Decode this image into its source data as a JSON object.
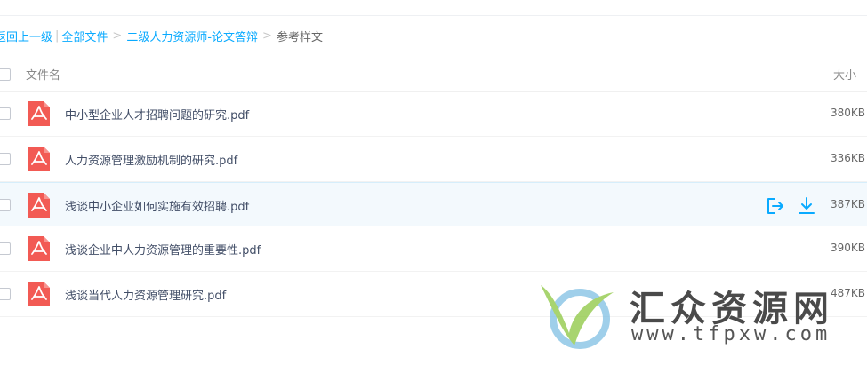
{
  "breadcrumb": {
    "back": "返回上一级",
    "divider": "|",
    "all_files": "全部文件",
    "folder": "二级人力资源师-论文答辩",
    "current": "参考样文",
    "sep": ">"
  },
  "header": {
    "name": "文件名",
    "size": "大小"
  },
  "files": [
    {
      "name": "中小型企业人才招聘问题的研究.pdf",
      "size": "380KB"
    },
    {
      "name": "人力资源管理激励机制的研究.pdf",
      "size": "336KB"
    },
    {
      "name": "浅谈中小企业如何实施有效招聘.pdf",
      "size": "387KB"
    },
    {
      "name": "浅谈企业中人力资源管理的重要性.pdf",
      "size": "390KB"
    },
    {
      "name": "浅谈当代人力资源管理研究.pdf",
      "size": "487KB"
    }
  ],
  "icons": {
    "file": "pdf-file-icon",
    "share": "share-export-icon",
    "download": "download-icon"
  },
  "colors": {
    "link": "#09aaff",
    "pdf": "#f25a54",
    "action": "#09aaff",
    "hover_row": "#f3f9fd"
  },
  "watermark": {
    "title": "汇众资源网",
    "url": "www.tfpxw.com"
  }
}
